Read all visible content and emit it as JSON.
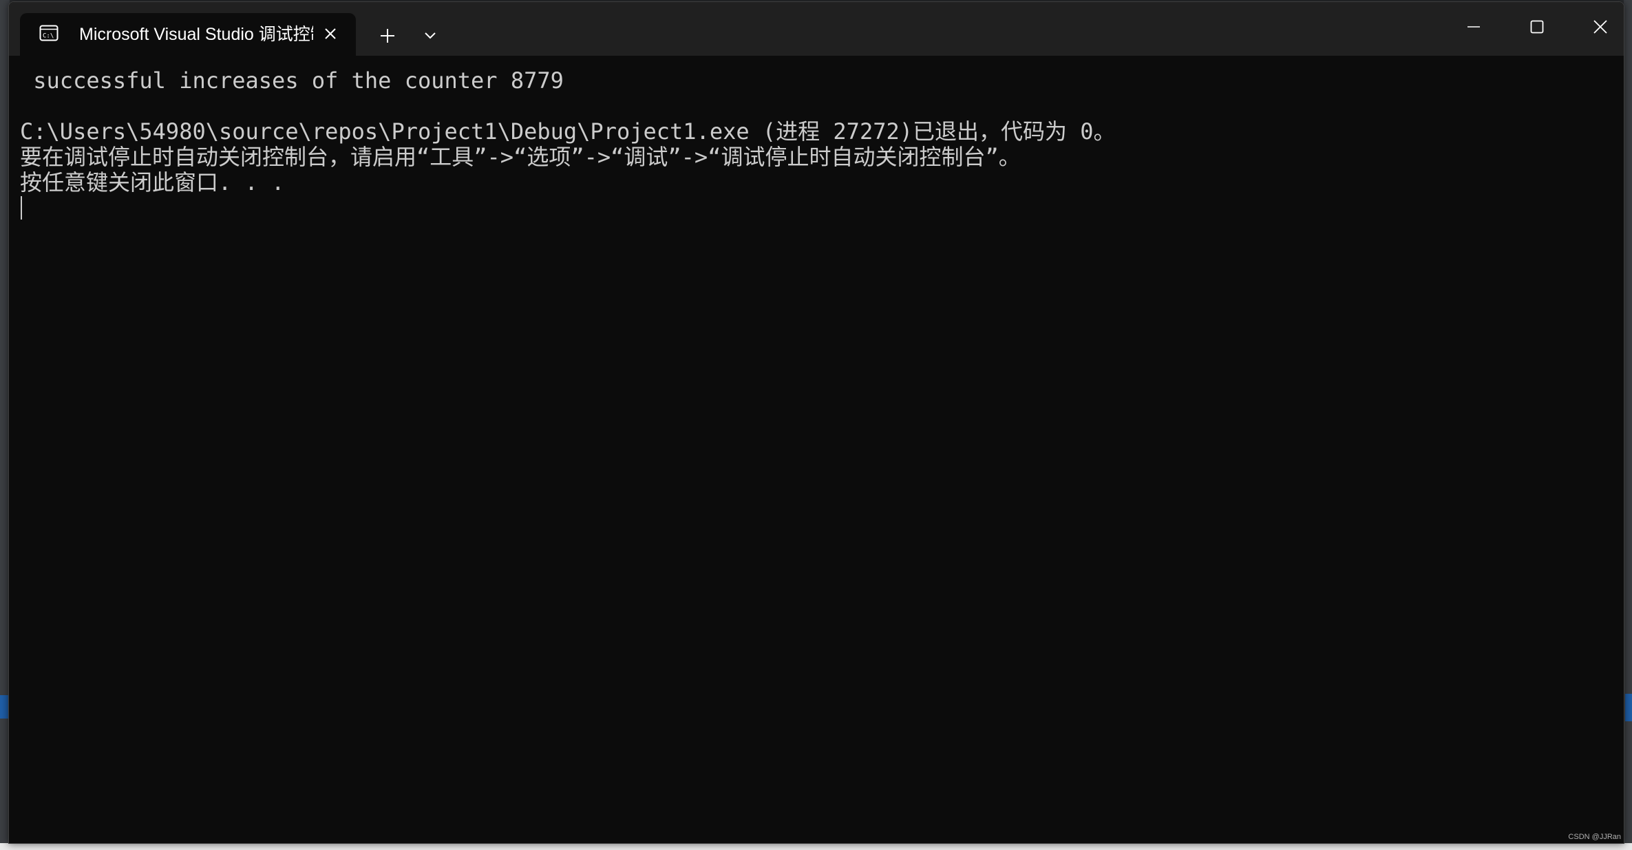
{
  "window": {
    "tab_title": "Microsoft Visual Studio 调试控制台",
    "tab_icon": "console-icon",
    "close_tab_icon": "close-icon",
    "new_tab_icon": "plus-icon",
    "dropdown_icon": "chevron-down-icon",
    "minimize_icon": "minimize-icon",
    "maximize_icon": "maximize-icon",
    "close_window_icon": "close-icon"
  },
  "console": {
    "lines": [
      " successful increases of the counter 8779",
      "",
      "C:\\Users\\54980\\source\\repos\\Project1\\Debug\\Project1.exe (进程 27272)已退出，代码为 0。",
      "要在调试停止时自动关闭控制台，请启用“工具”->“选项”->“调试”->“调试停止时自动关闭控制台”。",
      "按任意键关闭此窗口. . ."
    ]
  },
  "watermark": "CSDN @JJRan",
  "colors": {
    "console_bg": "#0c0c0c",
    "titlebar_bg": "#202020",
    "text": "#cccccc",
    "accent": "#1f5fa8"
  }
}
